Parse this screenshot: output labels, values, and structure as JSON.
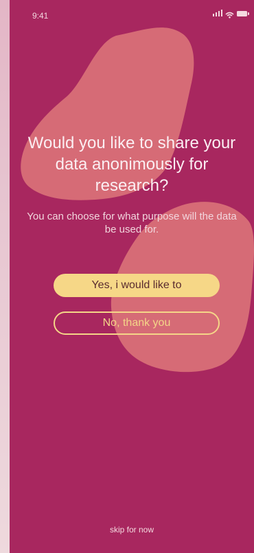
{
  "status_bar": {
    "time": "9:41",
    "icons": [
      "signal-icon",
      "wifi-icon",
      "battery-icon"
    ]
  },
  "prompt": {
    "title": "Would you like to share your data anonimously for research?",
    "subtitle": "You can choose for what purpose will the data be used for."
  },
  "actions": {
    "yes_label": "Yes, i would like to",
    "no_label": "No, thank you",
    "skip_label": "skip for now"
  },
  "colors": {
    "background": "#a8275f",
    "blob": "#d86f77",
    "primary_button": "#f6d787",
    "outline_button": "#f5d688",
    "text": "#fbeef2"
  }
}
